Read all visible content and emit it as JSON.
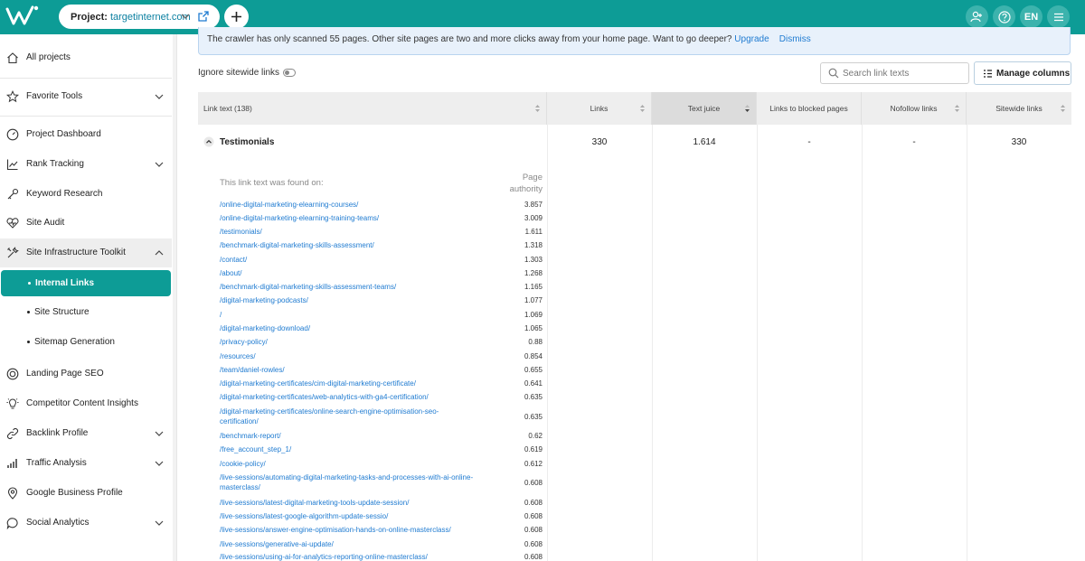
{
  "header": {
    "project_label": "Project:",
    "project_name": "targetinternet.com",
    "language": "EN",
    "icons": [
      "logo-icon",
      "chevron-down-icon",
      "external-link-icon",
      "plus-icon",
      "users-icon",
      "help-icon",
      "menu-icon"
    ]
  },
  "sidebar": {
    "all_projects": "All projects",
    "favorite_tools": "Favorite Tools",
    "project_dashboard": "Project Dashboard",
    "rank_tracking": "Rank Tracking",
    "keyword_research": "Keyword Research",
    "site_audit": "Site Audit",
    "site_infrastructure": "Site Infrastructure Toolkit",
    "internal_links": "Internal Links",
    "site_structure": "Site Structure",
    "sitemap_generation": "Sitemap Generation",
    "landing_page_seo": "Landing Page SEO",
    "competitor_content": "Competitor Content Insights",
    "backlink_profile": "Backlink Profile",
    "traffic_analysis": "Traffic Analysis",
    "google_business": "Google Business Profile",
    "social_analytics": "Social Analytics"
  },
  "banner": {
    "text": "The crawler has only scanned 55 pages. Other site pages are two and more clicks away from your home page. Want to go deeper?",
    "upgrade": "Upgrade",
    "dismiss": "Dismiss"
  },
  "toolbar": {
    "ignore_sitewide": "Ignore sitewide links",
    "search_placeholder": "Search link texts",
    "manage_columns": "Manage columns"
  },
  "table": {
    "headers": {
      "link_text": "Link text (138)",
      "links": "Links",
      "text_juice": "Text juice",
      "blocked": "Links to blocked pages",
      "nofollow": "Nofollow links",
      "sitewide": "Sitewide links"
    },
    "row": {
      "name": "Testimonials",
      "links": "330",
      "text_juice": "1.614",
      "blocked": "-",
      "nofollow": "-",
      "sitewide": "330"
    },
    "found_on_label": "This link text was found on:",
    "page_authority_label": "Page authority",
    "pages": [
      {
        "url": "/online-digital-marketing-elearning-courses/",
        "pa": "3.857"
      },
      {
        "url": "/online-digital-marketing-elearning-training-teams/",
        "pa": "3.009"
      },
      {
        "url": "/testimonials/",
        "pa": "1.611"
      },
      {
        "url": "/benchmark-digital-marketing-skills-assessment/",
        "pa": "1.318"
      },
      {
        "url": "/contact/",
        "pa": "1.303"
      },
      {
        "url": "/about/",
        "pa": "1.268"
      },
      {
        "url": "/benchmark-digital-marketing-skills-assessment-teams/",
        "pa": "1.165"
      },
      {
        "url": "/digital-marketing-podcasts/",
        "pa": "1.077"
      },
      {
        "url": "/",
        "pa": "1.069"
      },
      {
        "url": "/digital-marketing-download/",
        "pa": "1.065"
      },
      {
        "url": "/privacy-policy/",
        "pa": "0.88"
      },
      {
        "url": "/resources/",
        "pa": "0.854"
      },
      {
        "url": "/team/daniel-rowles/",
        "pa": "0.655"
      },
      {
        "url": "/digital-marketing-certificates/cim-digital-marketing-certificate/",
        "pa": "0.641"
      },
      {
        "url": "/digital-marketing-certificates/web-analytics-with-ga4-certification/",
        "pa": "0.635"
      },
      {
        "url": "/digital-marketing-certificates/online-search-engine-optimisation-seo-certification/",
        "pa": "0.635"
      },
      {
        "url": "/benchmark-report/",
        "pa": "0.62"
      },
      {
        "url": "/free_account_step_1/",
        "pa": "0.619"
      },
      {
        "url": "/cookie-policy/",
        "pa": "0.612"
      },
      {
        "url": "/live-sessions/automating-digital-marketing-tasks-and-processes-with-ai-online-masterclass/",
        "pa": "0.608"
      },
      {
        "url": "/live-sessions/latest-digital-marketing-tools-update-session/",
        "pa": "0.608"
      },
      {
        "url": "/live-sessions/latest-google-algorithm-update-sessio/",
        "pa": "0.608"
      },
      {
        "url": "/live-sessions/answer-engine-optimisation-hands-on-online-masterclass/",
        "pa": "0.608"
      },
      {
        "url": "/live-sessions/generative-ai-update/",
        "pa": "0.608"
      },
      {
        "url": "/live-sessions/using-ai-for-analytics-reporting-online-masterclass/",
        "pa": "0.608"
      }
    ]
  },
  "colors": {
    "brand": "#0d9c96",
    "link": "#1f7bd1",
    "banner_bg": "#e8f1fb"
  }
}
